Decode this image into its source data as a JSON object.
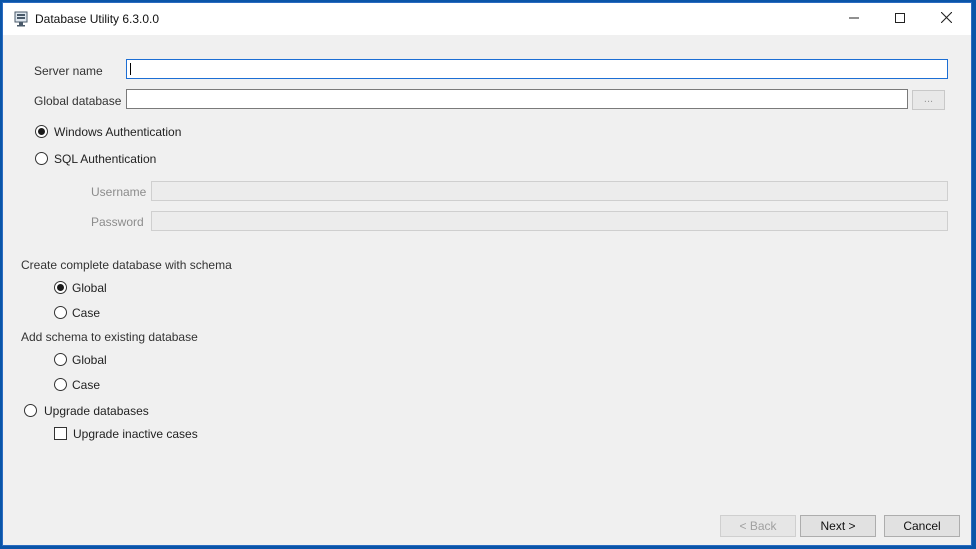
{
  "window": {
    "title": "Database Utility 6.3.0.0"
  },
  "connection": {
    "server_name_label": "Server name",
    "server_name_value": "",
    "global_database_label": "Global database",
    "global_database_value": "",
    "browse_label": "...",
    "windows_auth_label": "Windows Authentication",
    "sql_auth_label": "SQL Authentication",
    "username_label": "Username",
    "password_label": "Password",
    "selected_auth": "windows"
  },
  "create_section": {
    "heading": "Create complete database with schema",
    "global_label": "Global",
    "case_label": "Case"
  },
  "add_section": {
    "heading": "Add schema to existing database",
    "global_label": "Global",
    "case_label": "Case"
  },
  "upgrade": {
    "label": "Upgrade databases",
    "inactive_label": "Upgrade inactive cases",
    "inactive_checked": false
  },
  "buttons": {
    "back_label": "< Back",
    "next_label": "Next >",
    "cancel_label": "Cancel"
  }
}
